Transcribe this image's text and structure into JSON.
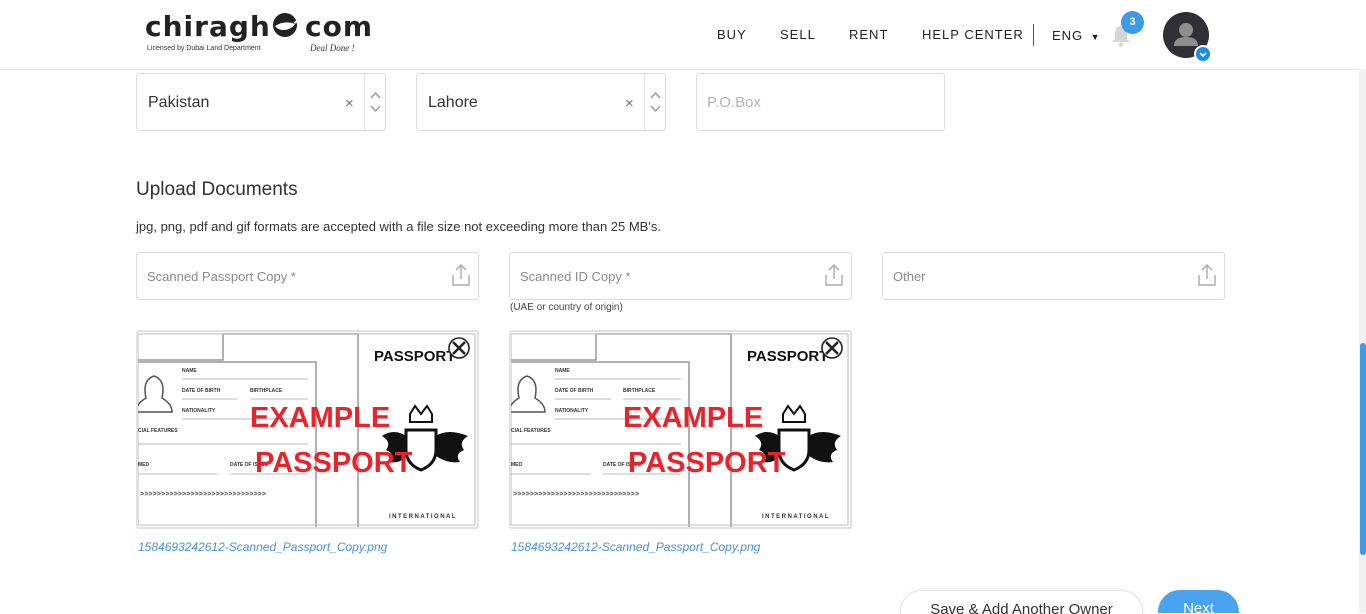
{
  "header": {
    "logo_left": "chiragh",
    "logo_right": "com",
    "logo_license": "Licensed by Dubai Land Department",
    "logo_tagline": "Deal Done !",
    "nav": [
      "BUY",
      "SELL",
      "RENT",
      "HELP CENTER"
    ],
    "language": "ENG",
    "notification_count": "3",
    "icons": [
      "bell-icon",
      "user-icon",
      "chevron-down-icon",
      "check-icon"
    ]
  },
  "address": {
    "country": "Pakistan",
    "city": "Lahore",
    "pobox_placeholder": "P.O.Box",
    "clear_symbol": "×"
  },
  "upload": {
    "title": "Upload Documents",
    "note": "jpg, png, pdf and gif formats are accepted with a file size not exceeding more than 25 MB's.",
    "fields": [
      {
        "label": "Scanned Passport Copy *"
      },
      {
        "label": "Scanned ID Copy *",
        "hint": "(UAE or country of origin)"
      },
      {
        "label": "Other"
      }
    ],
    "files": [
      {
        "name": "1584693242612-Scanned_Passport_Copy.png",
        "image_text": {
          "header": "PASSPORT",
          "line1": "EXAMPLE",
          "line2": "PASSPORT",
          "name": "NAME",
          "dob": "DATE OF BIRTH",
          "birthplace": "BIRTHPLACE",
          "nationality": "NATIONALITY",
          "features": "CIAL FEATURES",
          "med": "MED",
          "date_issue": "DATE OF ISSUE",
          "mrz": ">>>>>>>>>>>>>>>>>>>>>>>>>>>>>>",
          "international": "INTERNATIONAL"
        }
      },
      {
        "name": "1584693242612-Scanned_Passport_Copy.png",
        "image_text": {
          "header": "PASSPORT",
          "line1": "EXAMPLE",
          "line2": "PASSPORT",
          "name": "NAME",
          "dob": "DATE OF BIRTH",
          "birthplace": "BIRTHPLACE",
          "nationality": "NATIONALITY",
          "features": "CIAL FEATURES",
          "med": "MED",
          "date_issue": "DATE OF ISSUE",
          "mrz": ">>>>>>>>>>>>>>>>>>>>>>>>>>>>>>",
          "international": "INTERNATIONAL"
        }
      }
    ]
  },
  "actions": {
    "save_add": "Save & Add Another Owner",
    "next": "Next"
  },
  "colors": {
    "accent": "#4aa3ef",
    "link": "#4a90d9",
    "example_red": "#e8232c"
  }
}
